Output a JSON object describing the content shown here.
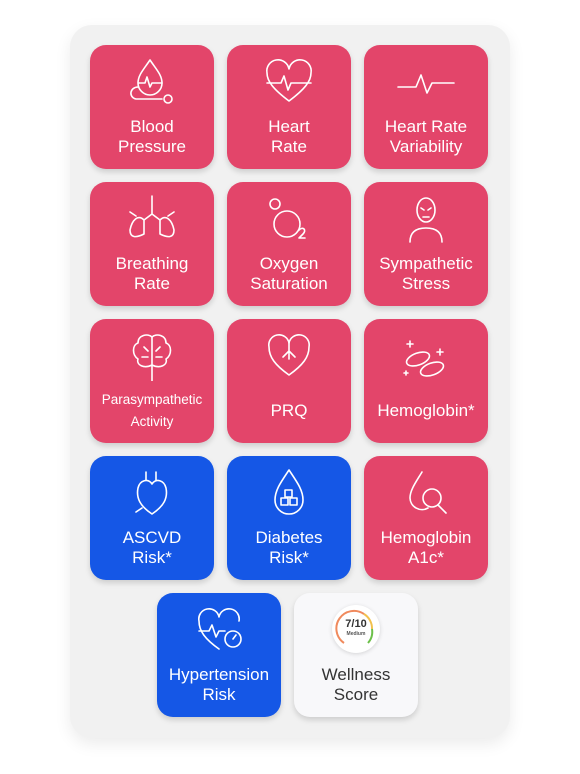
{
  "colors": {
    "risk_red": "#e3456a",
    "risk_blue": "#1557e6",
    "neutral": "#f8f8fa"
  },
  "tiles": [
    {
      "label": "Blood Pressure",
      "icon": "blood-pressure-icon"
    },
    {
      "label": "Heart Rate",
      "icon": "heart-rate-icon"
    },
    {
      "label": "Heart Rate Variability",
      "icon": "pulse-wave-icon"
    },
    {
      "label": "Breathing Rate",
      "icon": "lungs-icon"
    },
    {
      "label": "Oxygen Saturation",
      "icon": "oxygen-o2-icon"
    },
    {
      "label": "Sympathetic Stress",
      "icon": "stressed-person-icon"
    },
    {
      "label": "Parasympathetic Activity",
      "icon": "brain-icon"
    },
    {
      "label": "PRQ",
      "icon": "heart-lungs-icon"
    },
    {
      "label": "Hemoglobin*",
      "icon": "red-blood-cells-icon"
    },
    {
      "label": "ASCVD Risk*",
      "icon": "heart-arteries-icon"
    },
    {
      "label": "Diabetes Risk*",
      "icon": "sugar-drop-icon"
    },
    {
      "label": "Hemoglobin A1c*",
      "icon": "drop-magnifier-icon"
    },
    {
      "label": "Hypertension Risk",
      "icon": "heart-gauge-icon"
    },
    {
      "label": "Wellness Score",
      "icon": "score-gauge-icon"
    }
  ],
  "wellness": {
    "value": "7/10",
    "level": "Medium",
    "fraction": 0.7
  }
}
